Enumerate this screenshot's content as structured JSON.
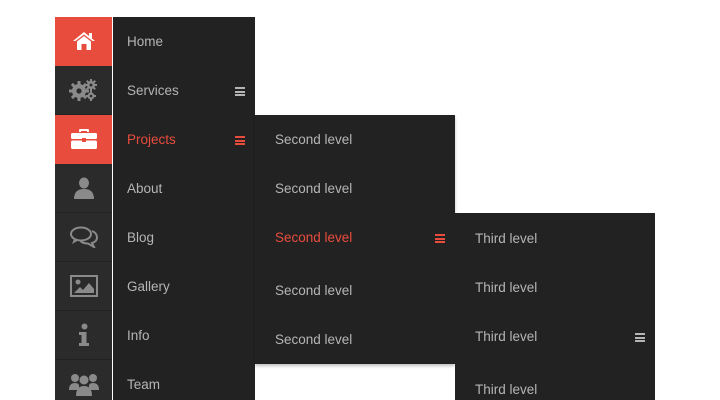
{
  "nav": {
    "icons": [
      {
        "icon": "home-icon",
        "active": true
      },
      {
        "icon": "gears-icon",
        "active": false
      },
      {
        "icon": "briefcase-icon",
        "active": true
      },
      {
        "icon": "user-icon",
        "active": false
      },
      {
        "icon": "chat-icon",
        "active": false
      },
      {
        "icon": "picture-icon",
        "active": false
      },
      {
        "icon": "info-icon",
        "active": false
      },
      {
        "icon": "group-icon",
        "active": false
      }
    ],
    "level1": [
      {
        "label": "Home"
      },
      {
        "label": "Services"
      },
      {
        "label": "Projects"
      },
      {
        "label": "About"
      },
      {
        "label": "Blog"
      },
      {
        "label": "Gallery"
      },
      {
        "label": "Info"
      },
      {
        "label": "Team"
      }
    ],
    "level2": [
      {
        "label": "Second level"
      },
      {
        "label": "Second level"
      },
      {
        "label": "Second level"
      },
      {
        "label": "Second level"
      },
      {
        "label": "Second level"
      }
    ],
    "level3": [
      {
        "label": "Third level"
      },
      {
        "label": "Third level"
      },
      {
        "label": "Third level"
      },
      {
        "label": "Third level"
      }
    ]
  },
  "colors": {
    "accent": "#e84c3d",
    "menu_bg": "#222222",
    "icon_bar_bg": "#2b2b2b",
    "text": "#b5b5b5"
  }
}
